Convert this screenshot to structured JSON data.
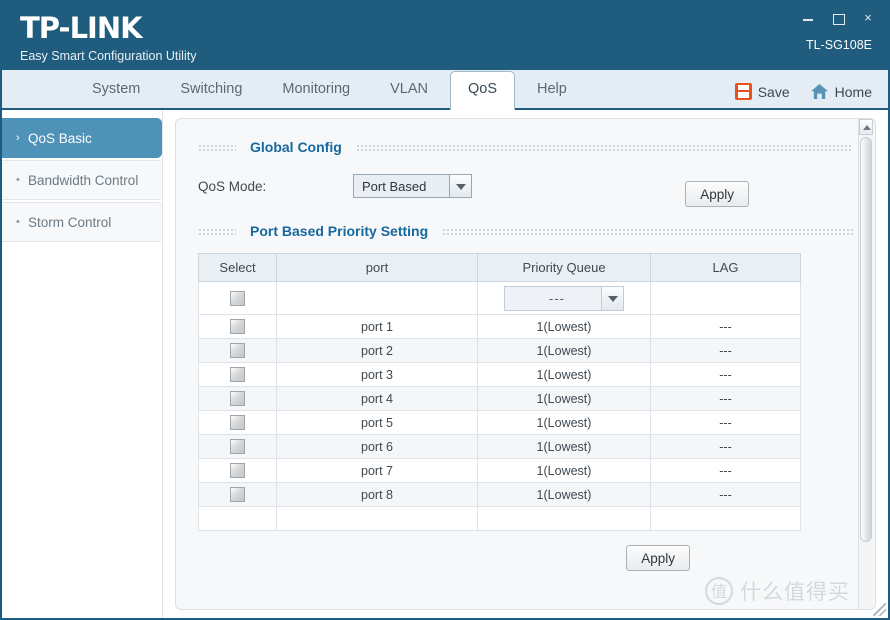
{
  "window": {
    "brand": "TP-LINK",
    "subtitle": "Easy Smart Configuration Utility",
    "model": "TL-SG108E",
    "minimize_label": "",
    "maximize_label": "",
    "close_label": "×"
  },
  "nav": {
    "tabs": [
      {
        "label": "System",
        "active": false
      },
      {
        "label": "Switching",
        "active": false
      },
      {
        "label": "Monitoring",
        "active": false
      },
      {
        "label": "VLAN",
        "active": false
      },
      {
        "label": "QoS",
        "active": true
      },
      {
        "label": "Help",
        "active": false
      }
    ],
    "actions": [
      {
        "label": "Save",
        "icon": "save-icon"
      },
      {
        "label": "Home",
        "icon": "home-icon"
      }
    ]
  },
  "sidebar": {
    "items": [
      {
        "label": "QoS Basic",
        "bullet": "›",
        "active": true
      },
      {
        "label": "Bandwidth Control",
        "bullet": "•",
        "active": false
      },
      {
        "label": "Storm Control",
        "bullet": "•",
        "active": false
      }
    ]
  },
  "main": {
    "global_config": {
      "section_title": "Global Config",
      "qos_mode_label": "QoS Mode:",
      "qos_mode_value": "Port Based",
      "apply_label": "Apply"
    },
    "port_priority": {
      "section_title": "Port Based Priority Setting",
      "columns": [
        "Select",
        "port",
        "Priority Queue",
        "LAG"
      ],
      "bulk_row": {
        "port": "",
        "priority_value": "---",
        "lag": ""
      },
      "rows": [
        {
          "port": "port 1",
          "priority": "1(Lowest)",
          "lag": "---"
        },
        {
          "port": "port 2",
          "priority": "1(Lowest)",
          "lag": "---"
        },
        {
          "port": "port 3",
          "priority": "1(Lowest)",
          "lag": "---"
        },
        {
          "port": "port 4",
          "priority": "1(Lowest)",
          "lag": "---"
        },
        {
          "port": "port 5",
          "priority": "1(Lowest)",
          "lag": "---"
        },
        {
          "port": "port 6",
          "priority": "1(Lowest)",
          "lag": "---"
        },
        {
          "port": "port 7",
          "priority": "1(Lowest)",
          "lag": "---"
        },
        {
          "port": "port 8",
          "priority": "1(Lowest)",
          "lag": "---"
        }
      ],
      "apply_label": "Apply"
    }
  },
  "watermark": {
    "mark": "值",
    "text": "什么值得买"
  },
  "colors": {
    "titlebar": "#1f5c7d",
    "navbar": "#e4edf4",
    "sidebar_active": "#4f92b8",
    "section_title": "#16689e",
    "save_icon": "#e8521d",
    "home_icon": "#5793b5"
  }
}
